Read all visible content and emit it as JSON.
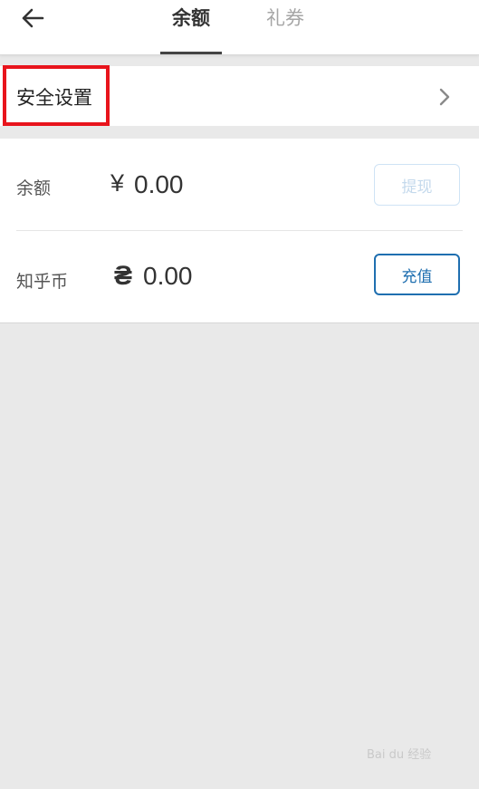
{
  "header": {
    "tabs": [
      {
        "label": "余额",
        "active": true
      },
      {
        "label": "礼券",
        "active": false
      }
    ]
  },
  "security": {
    "label": "安全设置"
  },
  "balance": {
    "label": "余额",
    "currency": "¥",
    "value": "0.00",
    "action_label": "提现"
  },
  "coins": {
    "label": "知乎币",
    "currency": "₴",
    "value": "0.00",
    "action_label": "充值"
  },
  "watermark": "Bai du 经验",
  "colors": {
    "accent": "#1f6fb0",
    "highlight": "#e8141c",
    "background": "#e9e9e9"
  }
}
